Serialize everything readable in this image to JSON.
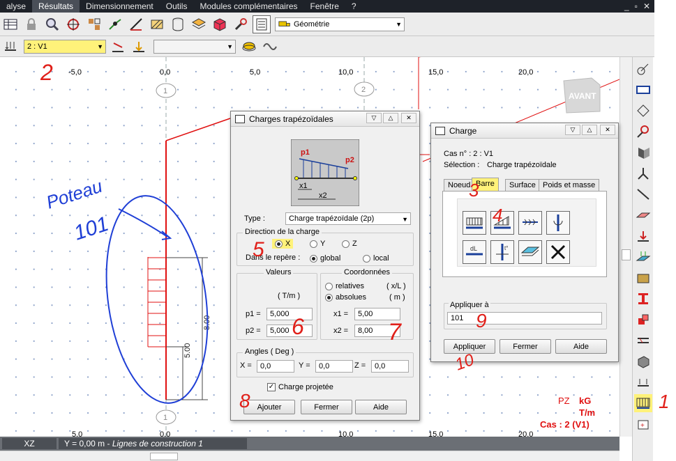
{
  "menu": {
    "items": [
      "alyse",
      "Résultats",
      "Dimensionnement",
      "Outils",
      "Modules complémentaires",
      "Fenêtre",
      "?"
    ],
    "active_index": 1,
    "window_controls": [
      "_",
      "▫",
      "✕"
    ]
  },
  "toolbar1": {
    "view_select": "Géométrie",
    "icons": [
      "table-icon",
      "lock-icon",
      "zoom-icon",
      "zoom-target-icon",
      "node-grid-icon",
      "release-icon",
      "measure-icon",
      "hatch-icon",
      "database-icon",
      "layers-icon",
      "cube-icon",
      "wrench-icon",
      "list-icon",
      "truck-icon"
    ]
  },
  "toolbar2": {
    "load_case_select": "2 : V1",
    "second_select": ""
  },
  "canvas": {
    "ruler_top": [
      "-5,0",
      "0,0",
      "5,0",
      "10,0",
      "15,0",
      "20,0"
    ],
    "ruler_bottom": [
      "5,0",
      "0,0",
      "10,0",
      "15,0",
      "20,0"
    ],
    "axis_labels": [
      "1",
      "2",
      "1"
    ],
    "dimension_labels": [
      "8.00",
      "5.00"
    ],
    "avant_label": "AVANT",
    "legend": {
      "pz": "PZ",
      "unit": "kG",
      "unit2": "T/m",
      "case": "Cas : 2 (V1)"
    }
  },
  "statusbar": {
    "plane": "XZ",
    "coord": "Y = 0,00 m - ",
    "coord_italic": "Lignes de construction 1"
  },
  "trap_dialog": {
    "title": "Charges trapézoïdales",
    "diagram_labels": {
      "p1": "p1",
      "p2": "p2",
      "x1": "x1",
      "x2": "x2"
    },
    "type_label": "Type :",
    "type_value": "Charge trapézoïdale (2p)",
    "direction_group": "Direction de la charge",
    "dir_x": "X",
    "dir_y": "Y",
    "dir_z": "Z",
    "repere_label": "Dans le repère :",
    "repere_global": "global",
    "repere_local": "local",
    "values_group": "Valeurs",
    "unit_tm": "( T/m )",
    "p1_label": "p1 =",
    "p1_value": "5,000",
    "p2_label": "p2 =",
    "p2_value": "5,000",
    "coords_group": "Coordonnées",
    "relatives": "relatives",
    "relatives_unit": "( x/L )",
    "absolues": "absolues",
    "absolues_unit": "( m )",
    "x1_label": "x1 =",
    "x1_value": "5,00",
    "x2_label": "x2 =",
    "x2_value": "8,00",
    "angles_group": "Angles ( Deg )",
    "ax_label": "X =",
    "ax_value": "0,0",
    "ay_label": "Y =",
    "ay_value": "0,0",
    "az_label": "Z =",
    "az_value": "0,0",
    "projected_label": "Charge projetée",
    "add_button": "Ajouter",
    "close_button": "Fermer",
    "help_button": "Aide"
  },
  "charge_dialog": {
    "title": "Charge",
    "case_line": "Cas n° : 2 : V1",
    "selection_label": "Sélection :",
    "selection_value": "Charge trapézoïdale",
    "tabs": [
      "Noeud",
      "Barre",
      "Surface",
      "Poids et masse"
    ],
    "active_tab": 1,
    "apply_to_label": "Appliquer à",
    "apply_to_value": "101",
    "apply_button": "Appliquer",
    "close_button": "Fermer",
    "help_button": "Aide"
  },
  "annotations": {
    "poteau": "Poteau",
    "poteau_num": "101",
    "n1": "1",
    "n2": "2",
    "n3": "3",
    "n4": "4",
    "n5": "5",
    "n6": "6",
    "n7": "7",
    "n8": "8",
    "n9": "9",
    "n10": "10"
  },
  "colors": {
    "highlight": "#fff27a",
    "ink_blue": "#1f3fd6",
    "ink_red": "#e0201a",
    "structure": "#e01010",
    "menubar": "#1e2229"
  }
}
